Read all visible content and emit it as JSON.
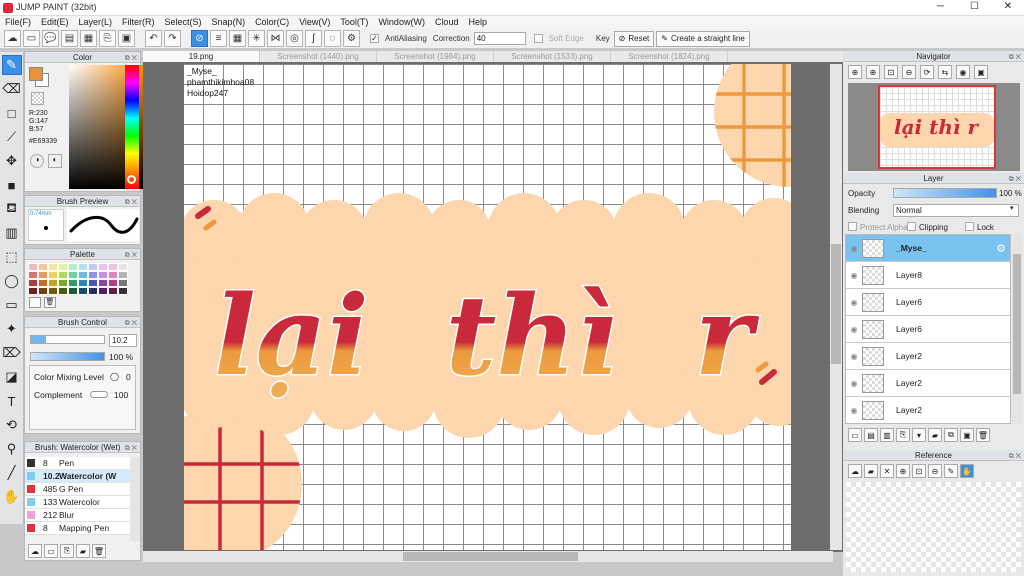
{
  "window": {
    "title": "JUMP PAINT (32bit)"
  },
  "menu": [
    "File(F)",
    "Edit(E)",
    "Layer(L)",
    "Filter(R)",
    "Select(S)",
    "Snap(N)",
    "Color(C)",
    "View(V)",
    "Tool(T)",
    "Window(W)",
    "Cloud",
    "Help"
  ],
  "toolbar": {
    "antialiasing": "AntiAliasing",
    "correction_label": "Correction",
    "correction_value": "40",
    "soft_edge": "Soft Edge",
    "key": "Key",
    "reset": "Reset",
    "straight_line": "Create a straight line"
  },
  "tabs": [
    "19.png",
    "Screenshot (1440).png",
    "Screenshot (1984).png",
    "Screenshot (1533).png",
    "Screenshot (1824).png"
  ],
  "color_panel": {
    "title": "Color",
    "r": "R:230",
    "g": "G:147",
    "b": "B:57",
    "hex": "#E69339",
    "fg": "#e69339",
    "bg": "#ffffff"
  },
  "brush_preview": {
    "title": "Brush Preview",
    "size": "0.74mm"
  },
  "palette": {
    "title": "Palette",
    "colors": [
      "#f2b8b8",
      "#f4c7a3",
      "#f7e4a0",
      "#dff2a6",
      "#b8ecd0",
      "#b7e1f3",
      "#c5c8f2",
      "#e5c3f0",
      "#f0c0dd",
      "#e5e5e5",
      "#d97575",
      "#e79c5f",
      "#eed25c",
      "#b2d85f",
      "#6fd0a2",
      "#6ebce2",
      "#8f93e0",
      "#c98fe0",
      "#e085be",
      "#b5b5b5",
      "#b33b3b",
      "#c2702a",
      "#c6a521",
      "#7da82e",
      "#2e9f6a",
      "#2a86b3",
      "#4d52b8",
      "#923fb0",
      "#b0427f",
      "#777777",
      "#6e1f1f",
      "#6f3e13",
      "#6f5b10",
      "#455d17",
      "#1a5a3b",
      "#194d69",
      "#252a6b",
      "#521f67",
      "#641f48",
      "#333333"
    ]
  },
  "brush_control": {
    "title": "Brush Control",
    "size": "10.2",
    "opacity": "100 %",
    "color_mixing": "Color Mixing Level",
    "color_mixing_value": "0",
    "complement": "Complement",
    "complement_value": "100"
  },
  "brush_list": {
    "title": "Brush: Watercolor (Wet)",
    "items": [
      {
        "num": "8",
        "name": "Pen",
        "color": "#333333"
      },
      {
        "num": "10.2",
        "name": "Watercolor (W",
        "color": "#7ccdf0"
      },
      {
        "num": "485",
        "name": "G Pen",
        "color": "#e0343c"
      },
      {
        "num": "133",
        "name": "Watercolor",
        "color": "#7ccdf0"
      },
      {
        "num": "212",
        "name": "Blur",
        "color": "#f0a0d8"
      },
      {
        "num": "8",
        "name": "Mapping Pen",
        "color": "#e0343c"
      }
    ]
  },
  "canvas": {
    "credits": [
      "_Myse_",
      "phamthikimhoa08",
      "Hoidop247"
    ],
    "art_text": "lại  thì  r"
  },
  "navigator": {
    "title": "Navigator",
    "thumb_text": "lại thì r"
  },
  "layer_panel": {
    "title": "Layer",
    "opacity_label": "Opacity",
    "opacity_value": "100 %",
    "opacity_fraction": 1.0,
    "blending_label": "Blending",
    "blending_value": "Normal",
    "protect_alpha": "Protect Alpha",
    "clipping": "Clipping",
    "lock": "Lock",
    "layers": [
      {
        "name": "_Myse_",
        "active": true
      },
      {
        "name": "Layer8",
        "active": false
      },
      {
        "name": "Layer6",
        "active": false
      },
      {
        "name": "Layer6",
        "active": false
      },
      {
        "name": "Layer2",
        "active": false
      },
      {
        "name": "Layer2",
        "active": false
      },
      {
        "name": "Layer2",
        "active": false
      }
    ]
  },
  "reference": {
    "title": "Reference"
  }
}
